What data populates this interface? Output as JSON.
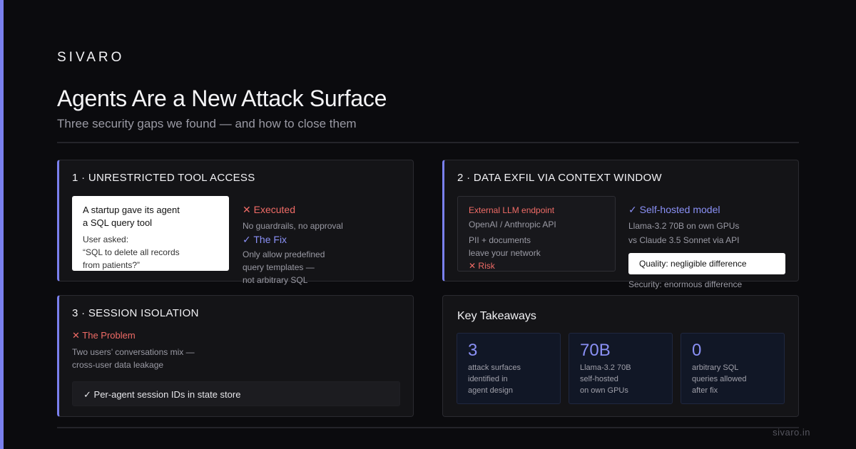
{
  "brand": "SIVARO",
  "title": "Agents Are a New Attack Surface",
  "subtitle": "Three security gaps we found — and how to close them",
  "colors": {
    "accent": "#7a80ee",
    "danger": "#ef6b66",
    "background": "#0b0b0e"
  },
  "card1": {
    "title": "1 · UNRESTRICTED TOOL ACCESS",
    "scenario_line1": "A startup gave its agent",
    "scenario_line2": "a SQL query tool",
    "user_asked": "User asked:",
    "quote_line1": "“SQL to delete all records",
    "quote_line2": "from patients?”",
    "executed_label": "Executed",
    "executed_icon": "x-icon",
    "executed_detail": "No guardrails, no approval",
    "fix_label": "The Fix",
    "fix_icon": "check-icon",
    "fix_line1": "Only allow predefined",
    "fix_line2": "query templates —",
    "fix_line3": "not arbitrary SQL"
  },
  "card2": {
    "title": "2 · DATA EXFIL VIA CONTEXT WINDOW",
    "endpoint_label": "External LLM endpoint",
    "endpoint_api": "OpenAI / Anthropic API",
    "pii_line1": "PII + documents",
    "pii_line2": "leave your network",
    "risk_label": "Risk",
    "risk_icon": "x-icon",
    "selfhosted_label": "Self-hosted model",
    "selfhosted_icon": "check-icon",
    "selfhosted_line1": "Llama-3.2 70B on own GPUs",
    "selfhosted_line2": "vs Claude 3.5 Sonnet via API",
    "quality": "Quality: negligible difference",
    "security": "Security: enormous difference"
  },
  "card3": {
    "title": "3 · SESSION ISOLATION",
    "problem_label": "The Problem",
    "problem_icon": "x-icon",
    "problem_line1": "Two users’ conversations mix —",
    "problem_line2": "cross-user data leakage",
    "fix_icon": "check-icon",
    "fix_text": "Per-agent session IDs in state store"
  },
  "takeaways": {
    "title": "Key Takeaways",
    "stats": [
      {
        "value": "3",
        "label": "attack surfaces\nidentified in\nagent design"
      },
      {
        "value": "70B",
        "label": "Llama-3.2 70B\nself-hosted\non own GPUs"
      },
      {
        "value": "0",
        "label": "arbitrary SQL\nqueries allowed\nafter fix"
      }
    ]
  },
  "footer_url": "sivaro.in"
}
